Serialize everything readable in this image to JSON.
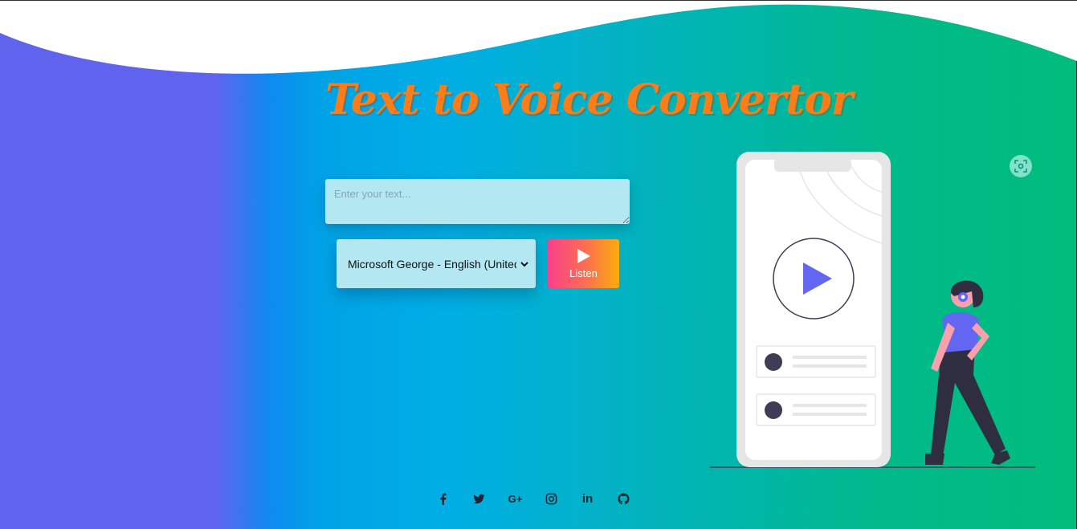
{
  "header": {
    "title": "Text to Voice Convertor"
  },
  "form": {
    "text_placeholder": "Enter your text...",
    "voice_selected": "Microsoft George - English (United",
    "listen_label": "Listen"
  },
  "social": {
    "google_plus_label": "G+",
    "linkedin_label": "in"
  },
  "icons": [
    "facebook-icon",
    "twitter-icon",
    "google-plus-icon",
    "instagram-icon",
    "linkedin-icon",
    "github-icon",
    "play-icon",
    "chevron-down-icon",
    "scan-icon"
  ],
  "colors": {
    "title": "#fb7d19",
    "input_bg": "#b3e7f2",
    "listen_gradient_start": "#fb3f8c",
    "listen_gradient_end": "#fbad0a",
    "illustration_accent": "#6366f1"
  }
}
